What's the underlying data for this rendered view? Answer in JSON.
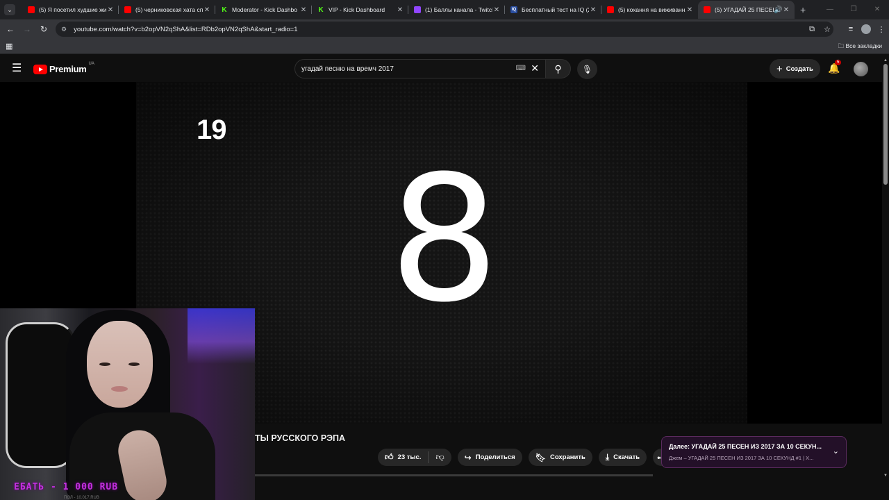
{
  "browser": {
    "tabs": [
      {
        "title": "(5) Я посетил худшие жи",
        "icon": "youtube-icon"
      },
      {
        "title": "(5) черниковская хата сп",
        "icon": "youtube-icon"
      },
      {
        "title": "Moderator - Kick Dashbo",
        "icon": "kick-icon"
      },
      {
        "title": "VIP - Kick Dashboard",
        "icon": "kick-icon"
      },
      {
        "title": "(1) Баллы канала - Twitch",
        "icon": "twitch-icon"
      },
      {
        "title": "Бесплатный тест на IQ (2",
        "icon": "iq-icon"
      },
      {
        "title": "(5) кохання на виживання",
        "icon": "youtube-icon"
      },
      {
        "title": "(5) УГАДАЙ 25 ПЕСЕН",
        "icon": "youtube-icon",
        "active": true
      }
    ],
    "url": "youtube.com/watch?v=b2opVN2qShA&list=RDb2opVN2qShA&start_radio=1",
    "bookmarks_label": "Все закладки"
  },
  "youtube": {
    "logo_text": "Premium",
    "region": "UA",
    "search_value": "угадай песню на времч 2017",
    "create_label": "Создать",
    "notification_count": "5"
  },
  "video": {
    "counter": "19",
    "big_number": "8",
    "title_fragment": "ТЫ РУССКОГО РЭПА",
    "likes": "23 тыс.",
    "share_label": "Поделиться",
    "save_label": "Сохранить",
    "download_label": "Скачать"
  },
  "webcam": {
    "donation_text": "ЕБАТЬ - 1 000 RUB",
    "footer_text": "ПОЛ - 10.017.RUB"
  },
  "up_next": {
    "line1": "Далее: УГАДАЙ 25 ПЕСЕН ИЗ 2017 ЗА 10 СЕКУН...",
    "line2": "Джем – УГАДАЙ 25 ПЕСЕН ИЗ 2017 ЗА 10 СЕКУНД #1 | Х..."
  }
}
